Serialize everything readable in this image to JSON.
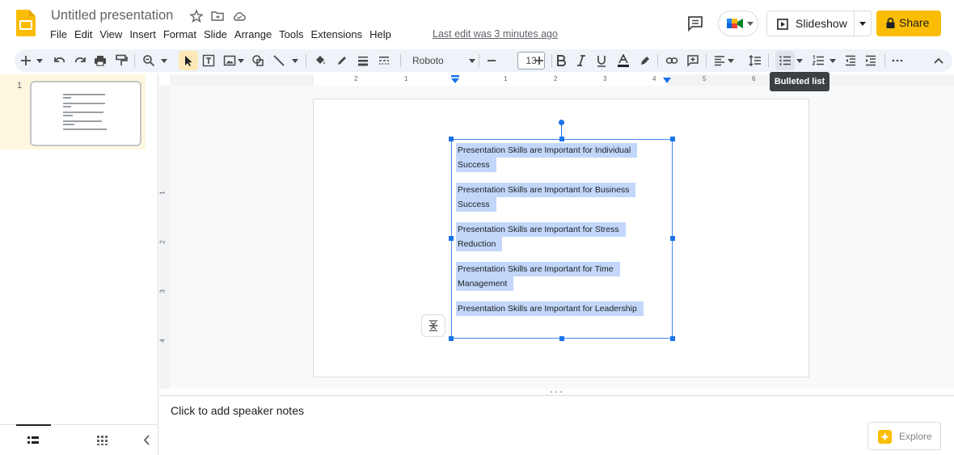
{
  "header": {
    "title": "Untitled presentation",
    "menu": [
      "File",
      "Edit",
      "View",
      "Insert",
      "Format",
      "Slide",
      "Arrange",
      "Tools",
      "Extensions",
      "Help"
    ],
    "last_edit": "Last edit was 3 minutes ago",
    "slideshow_label": "Slideshow",
    "share_label": "Share"
  },
  "toolbar": {
    "font": "Roboto",
    "font_size": "13",
    "tooltip": "Bulleted list"
  },
  "ruler": {
    "h_labels": [
      "2",
      "1",
      "1",
      "2",
      "3",
      "4",
      "5",
      "6"
    ],
    "v_labels": [
      "1",
      "2",
      "3",
      "4"
    ]
  },
  "filmstrip": {
    "slide_number": "1"
  },
  "slide": {
    "paragraphs": [
      [
        "Presentation Skills are Important for Individual",
        "Success"
      ],
      [
        "Presentation Skills are Important for Business",
        "Success"
      ],
      [
        "Presentation Skills are Important for Stress",
        "Reduction"
      ],
      [
        "Presentation Skills are Important for Time",
        "Management"
      ],
      [
        "Presentation Skills are Important for Leadership"
      ]
    ]
  },
  "notes": {
    "placeholder": "Click to add speaker notes"
  },
  "explore": {
    "label": "Explore"
  },
  "colors": {
    "brand": "#fbbc04",
    "selection": "#c2d7fa",
    "accent": "#1a73e8"
  }
}
